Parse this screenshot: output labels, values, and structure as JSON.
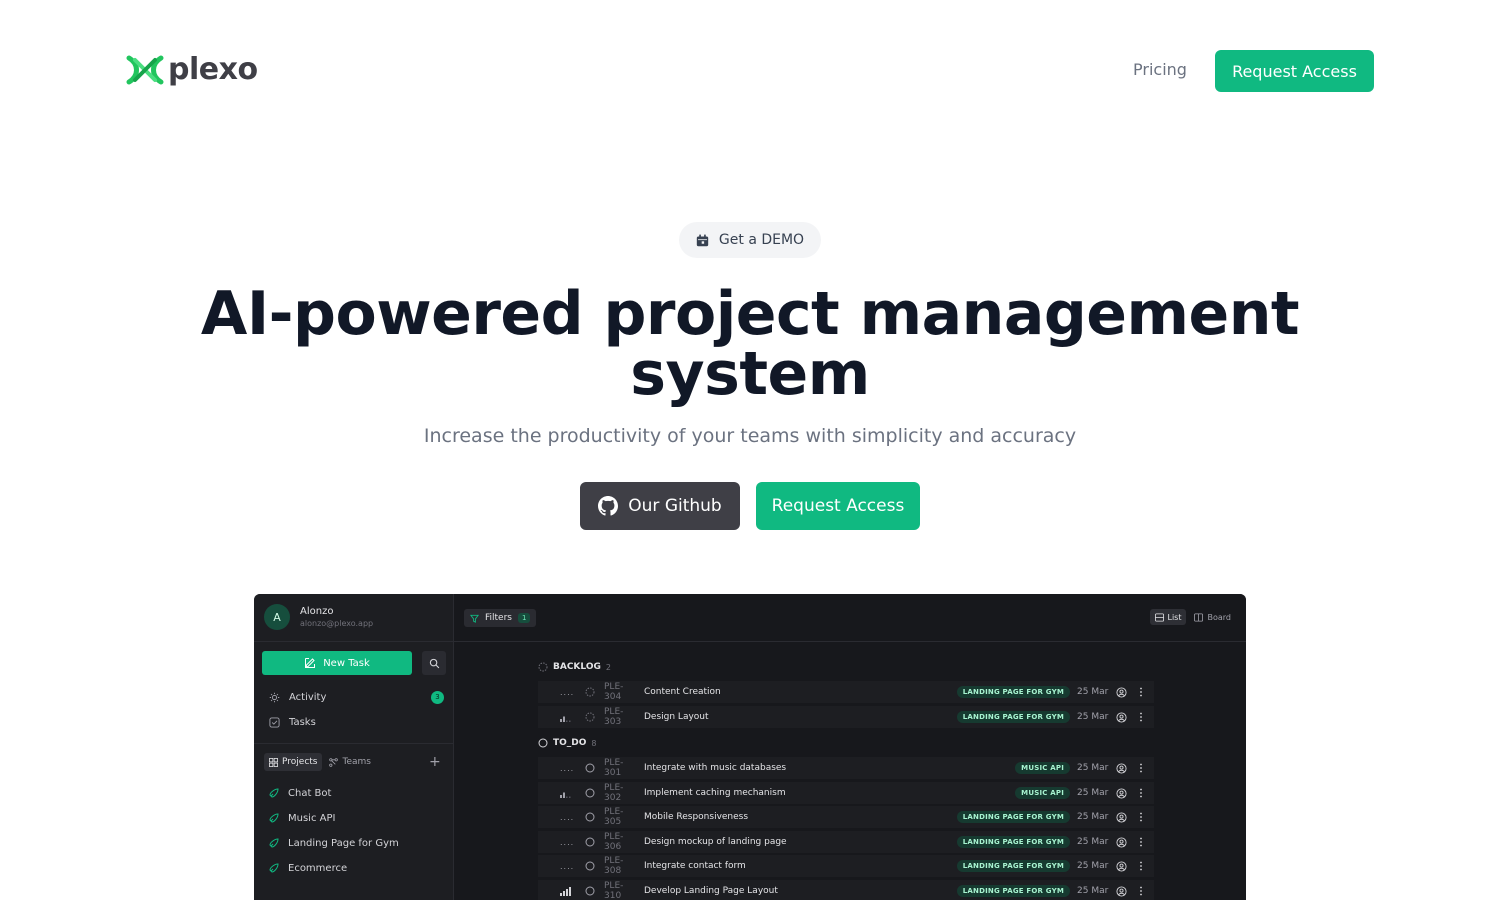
{
  "brand": {
    "name": "plexo",
    "accent": "#10b981",
    "dark": "#3f3f46"
  },
  "nav": {
    "pricing": "Pricing",
    "request_access": "Request Access"
  },
  "hero": {
    "demo_label": "Get a DEMO",
    "title": "AI-powered project management system",
    "subtitle": "Increase the productivity of your teams with simplicity and accuracy",
    "github_label": "Our Github",
    "request_access": "Request Access"
  },
  "app": {
    "user": {
      "initial": "A",
      "name": "Alonzo",
      "email": "alonzo@plexo.app"
    },
    "new_task": "New Task",
    "menu": [
      {
        "label": "Activity",
        "badge": "3",
        "icon": "sun-icon"
      },
      {
        "label": "Tasks",
        "icon": "checkbox-icon"
      }
    ],
    "segments": {
      "projects": "Projects",
      "teams": "Teams"
    },
    "projects": [
      "Chat Bot",
      "Music API",
      "Landing Page for Gym",
      "Ecommerce"
    ],
    "toolbar": {
      "filters": "Filters",
      "filters_count": "1",
      "list": "List",
      "board": "Board"
    },
    "groups": [
      {
        "name": "BACKLOG",
        "count": "2",
        "tasks": [
          {
            "priority": "none",
            "id": "PLE-304",
            "title": "Content Creation",
            "project": "LANDING PAGE FOR GYM",
            "date": "25 Mar"
          },
          {
            "priority": "medium",
            "id": "PLE-303",
            "title": "Design Layout",
            "project": "LANDING PAGE FOR GYM",
            "date": "25 Mar"
          }
        ]
      },
      {
        "name": "TO_DO",
        "count": "8",
        "tasks": [
          {
            "priority": "none",
            "id": "PLE-301",
            "title": "Integrate with music databases",
            "project": "MUSIC API",
            "date": "25 Mar"
          },
          {
            "priority": "medium",
            "id": "PLE-302",
            "title": "Implement caching mechanism",
            "project": "MUSIC API",
            "date": "25 Mar"
          },
          {
            "priority": "none",
            "id": "PLE-305",
            "title": "Mobile Responsiveness",
            "project": "LANDING PAGE FOR GYM",
            "date": "25 Mar"
          },
          {
            "priority": "none",
            "id": "PLE-306",
            "title": "Design mockup of landing page",
            "project": "LANDING PAGE FOR GYM",
            "date": "25 Mar"
          },
          {
            "priority": "none",
            "id": "PLE-308",
            "title": "Integrate contact form",
            "project": "LANDING PAGE FOR GYM",
            "date": "25 Mar"
          },
          {
            "priority": "high",
            "id": "PLE-310",
            "title": "Develop Landing Page Layout",
            "project": "LANDING PAGE FOR GYM",
            "date": "25 Mar"
          }
        ]
      }
    ]
  }
}
